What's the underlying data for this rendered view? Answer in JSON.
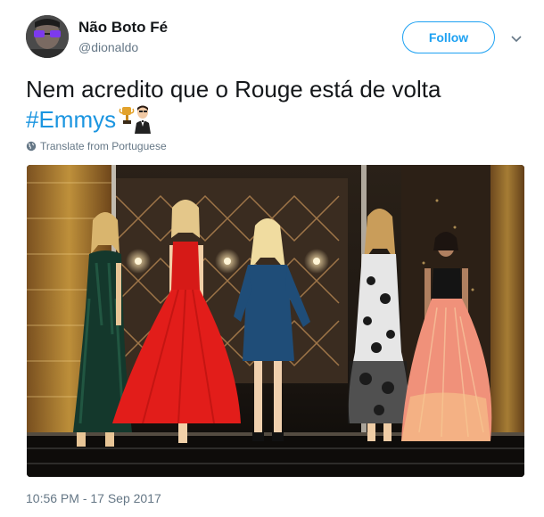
{
  "author": {
    "name": "Não Boto Fé",
    "handle": "@dionaldo"
  },
  "follow_label": "Follow",
  "tweet": {
    "text_line1": "Nem acredito que o Rouge está de volta",
    "hashtag": "#Emmys"
  },
  "translate_label": "Translate from Portuguese",
  "timestamp": "10:56 PM - 17 Sep 2017",
  "colors": {
    "accent": "#1da1f2",
    "hashtag": "#1b95e0",
    "secondary_text": "#657786",
    "primary_text": "#14171a"
  },
  "icons": [
    "avatar-photo",
    "caret-down-icon",
    "trophy-emoji",
    "man-in-suit-emoji",
    "globe-icon"
  ]
}
